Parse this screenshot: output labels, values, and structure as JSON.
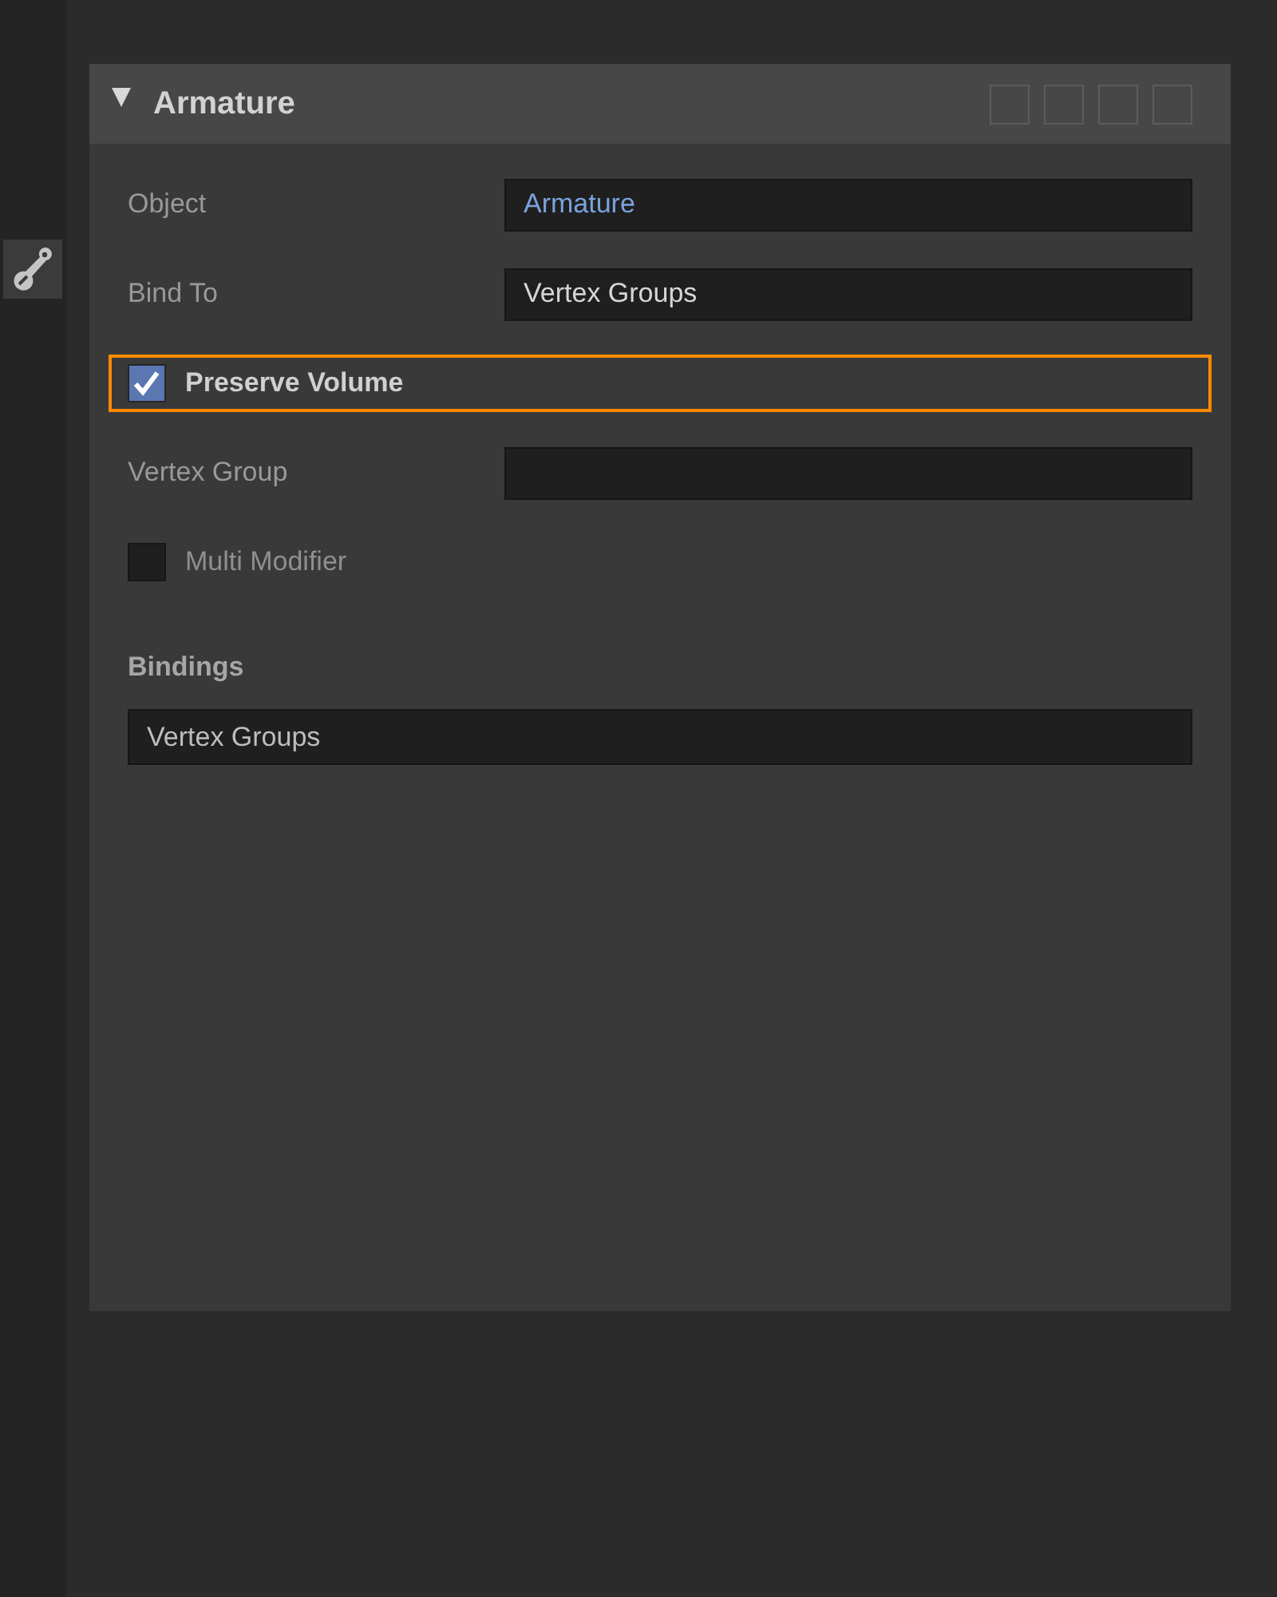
{
  "sidebar_tabs": [
    {
      "selected": true
    }
  ],
  "panel": {
    "title": "Armature",
    "expanded": true
  },
  "rows": [
    {
      "kind": "object",
      "label": "Object",
      "value": "Armature"
    },
    {
      "kind": "select",
      "label": "Bind To",
      "value": "Vertex Groups"
    },
    {
      "kind": "checkbox",
      "label": "Preserve Volume",
      "checked": true,
      "focused": true
    },
    {
      "kind": "select",
      "label": "Vertex Group"
    },
    {
      "kind": "checkbox",
      "label": "Multi Modifier",
      "checked": false,
      "focused": false
    }
  ],
  "bindings": {
    "title": "Bindings",
    "value": "Vertex Groups"
  }
}
